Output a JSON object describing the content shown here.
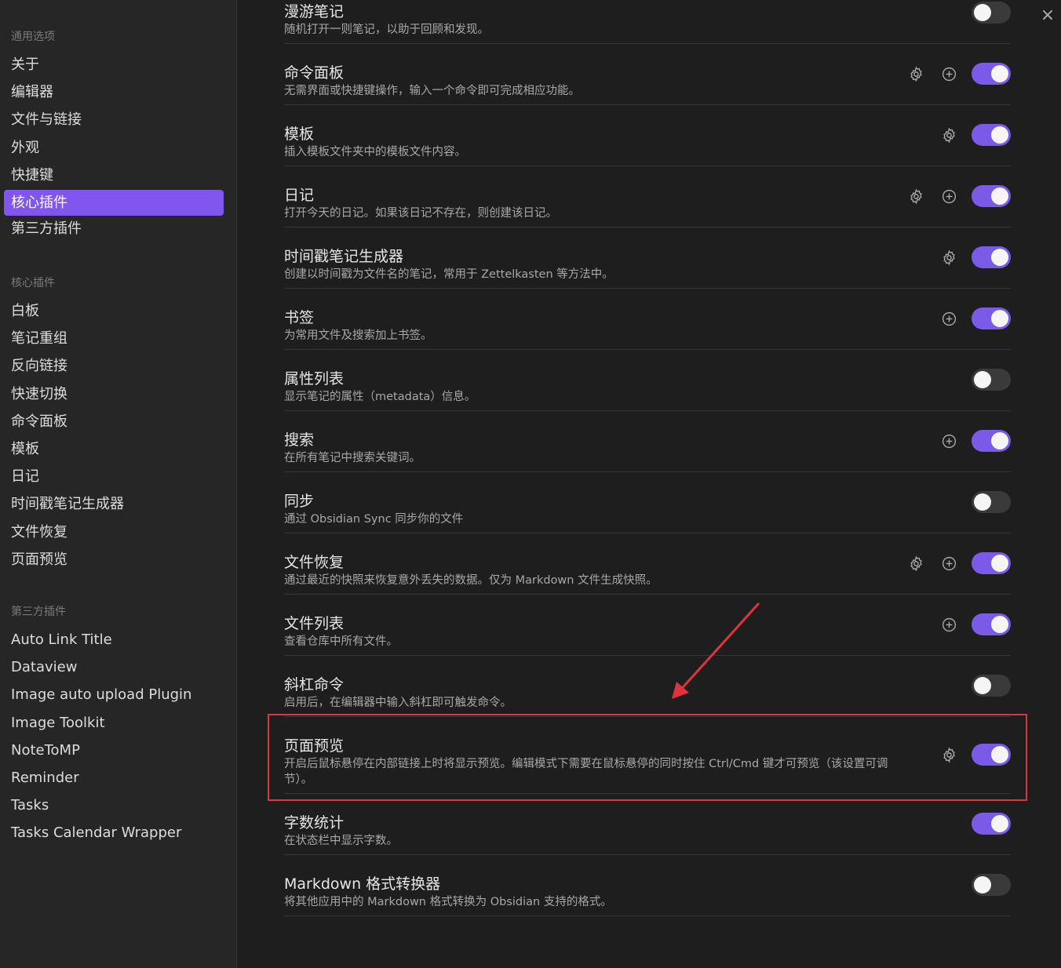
{
  "sidebar": {
    "general_title": "通用选项",
    "general_items": [
      "关于",
      "编辑器",
      "文件与链接",
      "外观",
      "快捷键",
      "核心插件",
      "第三方插件"
    ],
    "core_title": "核心插件",
    "core_items": [
      "白板",
      "笔记重组",
      "反向链接",
      "快速切换",
      "命令面板",
      "模板",
      "日记",
      "时间戳笔记生成器",
      "文件恢复",
      "页面预览"
    ],
    "third_title": "第三方插件",
    "third_items": [
      "Auto Link Title",
      "Dataview",
      "Image auto upload Plugin",
      "Image Toolkit",
      "NoteToMP",
      "Reminder",
      "Tasks",
      "Tasks Calendar Wrapper"
    ]
  },
  "plugins": [
    {
      "name": "漫游笔记",
      "desc": "随机打开一则笔记，以助于回顾和发现。",
      "settings": false,
      "add": false,
      "enabled": false
    },
    {
      "name": "命令面板",
      "desc": "无需界面或快捷键操作，输入一个命令即可完成相应功能。",
      "settings": true,
      "add": true,
      "enabled": true
    },
    {
      "name": "模板",
      "desc": "插入模板文件夹中的模板文件内容。",
      "settings": true,
      "add": false,
      "enabled": true
    },
    {
      "name": "日记",
      "desc": "打开今天的日记。如果该日记不存在，则创建该日记。",
      "settings": true,
      "add": true,
      "enabled": true
    },
    {
      "name": "时间戳笔记生成器",
      "desc": "创建以时间戳为文件名的笔记，常用于 Zettelkasten 等方法中。",
      "settings": true,
      "add": false,
      "enabled": true
    },
    {
      "name": "书签",
      "desc": "为常用文件及搜索加上书签。",
      "settings": false,
      "add": true,
      "enabled": true
    },
    {
      "name": "属性列表",
      "desc": "显示笔记的属性（metadata）信息。",
      "settings": false,
      "add": false,
      "enabled": false
    },
    {
      "name": "搜索",
      "desc": "在所有笔记中搜索关键词。",
      "settings": false,
      "add": true,
      "enabled": true
    },
    {
      "name": "同步",
      "desc": "通过 Obsidian Sync 同步你的文件",
      "settings": false,
      "add": false,
      "enabled": false
    },
    {
      "name": "文件恢复",
      "desc": "通过最近的快照来恢复意外丢失的数据。仅为 Markdown 文件生成快照。",
      "settings": true,
      "add": true,
      "enabled": true
    },
    {
      "name": "文件列表",
      "desc": "查看仓库中所有文件。",
      "settings": false,
      "add": true,
      "enabled": true
    },
    {
      "name": "斜杠命令",
      "desc": "启用后，在编辑器中输入斜杠即可触发命令。",
      "settings": false,
      "add": false,
      "enabled": false
    },
    {
      "name": "页面预览",
      "desc": "开启后鼠标悬停在内部链接上时将显示预览。编辑模式下需要在鼠标悬停的同时按住 Ctrl/Cmd 键才可预览（该设置可调节）。",
      "settings": true,
      "add": false,
      "enabled": true
    },
    {
      "name": "字数统计",
      "desc": "在状态栏中显示字数。",
      "settings": false,
      "add": false,
      "enabled": true
    },
    {
      "name": "Markdown 格式转换器",
      "desc": "将其他应用中的 Markdown 格式转换为 Obsidian 支持的格式。",
      "settings": false,
      "add": false,
      "enabled": false
    }
  ],
  "close_icon": "×",
  "colors": {
    "accent": "#7b5ae8",
    "highlight": "#e0343c"
  }
}
